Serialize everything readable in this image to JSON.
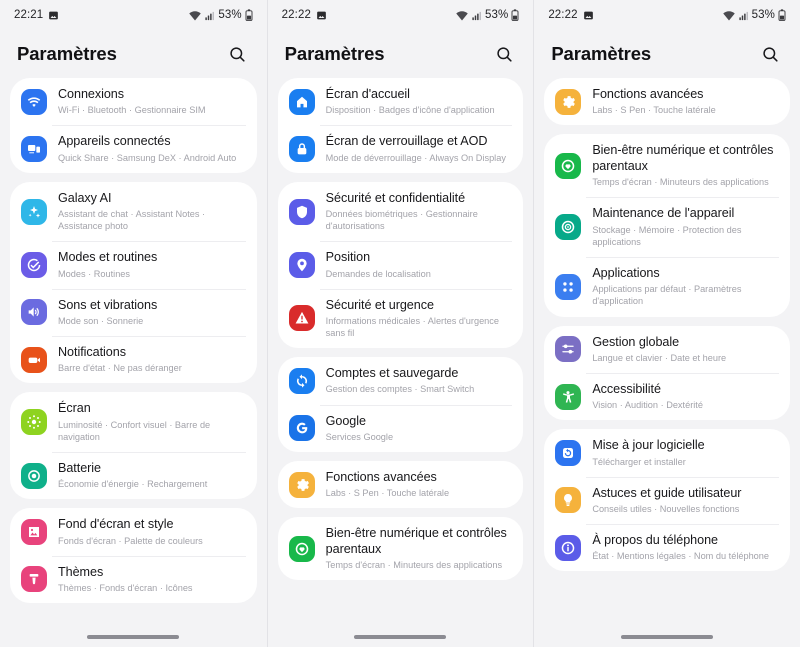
{
  "app": {
    "title": "Paramètres"
  },
  "status": {
    "time_col1": "22:21",
    "time_col2": "22:22",
    "time_col3": "22:22",
    "battery": "53%",
    "icons": [
      "gallery-icon",
      "wifi-icon",
      "signal-icon",
      "battery-icon"
    ]
  },
  "icon_colors": {
    "connexions": "#2c74f0",
    "appareils_connectes": "#2c74f0",
    "galaxy_ai": "#2fb7e8",
    "modes_routines": "#6b5ce7",
    "sons_vibrations": "#6b6be0",
    "notifications": "#e8521a",
    "ecran": "#8ed320",
    "batterie": "#0fb08a",
    "fond_ecran": "#e8437c",
    "themes": "#e8437c",
    "ecran_accueil": "#1a7ef0",
    "ecran_verrouillage": "#1a7ef0",
    "securite_conf": "#5b5ce8",
    "position": "#5b5ce8",
    "securite_urgence": "#d92b2b",
    "comptes": "#1a7ef0",
    "google": "#1a73e8",
    "fonctions_avancees": "#f5b23c",
    "bien_etre": "#18b84a",
    "maintenance": "#07a989",
    "applications": "#3b7ef0",
    "gestion_globale": "#7b6fc4",
    "accessibilite": "#2fb552",
    "mise_a_jour": "#2c74f0",
    "astuces": "#f5b23c",
    "a_propos": "#5b5ce8"
  },
  "columns": [
    {
      "name": "column-1",
      "cards": [
        {
          "rows": [
            {
              "icon": "wifi-icon",
              "key": "connexions",
              "title": "Connexions",
              "sub": "Wi-Fi  ·  Bluetooth  ·  Gestionnaire SIM"
            },
            {
              "icon": "devices-icon",
              "key": "appareils_connectes",
              "title": "Appareils connectés",
              "sub": "Quick Share  ·  Samsung DeX  ·  Android Auto"
            }
          ]
        },
        {
          "rows": [
            {
              "icon": "sparkle-icon",
              "key": "galaxy_ai",
              "title": "Galaxy AI",
              "sub": "Assistant de chat  ·  Assistant Notes  ·  Assistance photo"
            },
            {
              "icon": "check-circle-icon",
              "key": "modes_routines",
              "title": "Modes et routines",
              "sub": "Modes  ·  Routines"
            },
            {
              "icon": "speaker-icon",
              "key": "sons_vibrations",
              "title": "Sons et vibrations",
              "sub": "Mode son  ·  Sonnerie"
            },
            {
              "icon": "bell-icon",
              "key": "notifications",
              "title": "Notifications",
              "sub": "Barre d'état  ·  Ne pas déranger"
            }
          ]
        },
        {
          "rows": [
            {
              "icon": "brightness-icon",
              "key": "ecran",
              "title": "Écran",
              "sub": "Luminosité  ·  Confort visuel  ·  Barre de navigation"
            },
            {
              "icon": "battery-ring-icon",
              "key": "batterie",
              "title": "Batterie",
              "sub": "Économie d'énergie  ·  Rechargement"
            }
          ]
        },
        {
          "rows": [
            {
              "icon": "wallpaper-icon",
              "key": "fond_ecran",
              "title": "Fond d'écran et style",
              "sub": "Fonds d'écran  ·  Palette de couleurs"
            },
            {
              "icon": "brush-icon",
              "key": "themes",
              "title": "Thèmes",
              "sub": "Thèmes  ·  Fonds d'écran  ·  Icônes"
            }
          ]
        }
      ]
    },
    {
      "name": "column-2",
      "cards": [
        {
          "rows": [
            {
              "icon": "home-icon",
              "key": "ecran_accueil",
              "title": "Écran d'accueil",
              "sub": "Disposition  ·  Badges d'icône d'application"
            },
            {
              "icon": "lock-icon",
              "key": "ecran_verrouillage",
              "title": "Écran de verrouillage et AOD",
              "sub": "Mode de déverrouillage  ·  Always On Display"
            }
          ]
        },
        {
          "rows": [
            {
              "icon": "shield-icon",
              "key": "securite_conf",
              "title": "Sécurité et confidentialité",
              "sub": "Données biométriques  ·  Gestionnaire d'autorisations"
            },
            {
              "icon": "pin-icon",
              "key": "position",
              "title": "Position",
              "sub": "Demandes de localisation"
            },
            {
              "icon": "alert-icon",
              "key": "securite_urgence",
              "title": "Sécurité et urgence",
              "sub": "Informations médicales  ·  Alertes d'urgence sans fil"
            }
          ]
        },
        {
          "rows": [
            {
              "icon": "sync-icon",
              "key": "comptes",
              "title": "Comptes et sauvegarde",
              "sub": "Gestion des comptes  ·  Smart Switch"
            },
            {
              "icon": "google-icon",
              "key": "google",
              "title": "Google",
              "sub": "Services Google"
            }
          ]
        },
        {
          "rows": [
            {
              "icon": "gear-icon",
              "key": "fonctions_avancees",
              "title": "Fonctions avancées",
              "sub": "Labs  ·  S Pen  ·  Touche latérale"
            }
          ]
        },
        {
          "rows": [
            {
              "icon": "heart-icon",
              "key": "bien_etre",
              "title": "Bien-être numérique et contrôles parentaux",
              "sub": "Temps d'écran  ·  Minuteurs des applications"
            }
          ]
        }
      ]
    },
    {
      "name": "column-3",
      "cards": [
        {
          "rows": [
            {
              "icon": "gear-icon",
              "key": "fonctions_avancees",
              "title": "Fonctions avancées",
              "sub": "Labs  ·  S Pen  ·  Touche latérale"
            }
          ]
        },
        {
          "rows": [
            {
              "icon": "heart-icon",
              "key": "bien_etre",
              "title": "Bien-être numérique et contrôles parentaux",
              "sub": "Temps d'écran  ·  Minuteurs des applications"
            },
            {
              "icon": "maintenance-icon",
              "key": "maintenance",
              "title": "Maintenance de l'appareil",
              "sub": "Stockage  ·  Mémoire  ·  Protection des applications"
            },
            {
              "icon": "apps-grid-icon",
              "key": "applications",
              "title": "Applications",
              "sub": "Applications par défaut  ·  Paramètres d'application"
            }
          ]
        },
        {
          "rows": [
            {
              "icon": "sliders-icon",
              "key": "gestion_globale",
              "title": "Gestion globale",
              "sub": "Langue et clavier  ·  Date et heure"
            },
            {
              "icon": "accessibility-icon",
              "key": "accessibilite",
              "title": "Accessibilité",
              "sub": "Vision  ·  Audition  ·  Dextérité"
            }
          ]
        },
        {
          "rows": [
            {
              "icon": "update-icon",
              "key": "mise_a_jour",
              "title": "Mise à jour logicielle",
              "sub": "Télécharger et installer"
            },
            {
              "icon": "bulb-icon",
              "key": "astuces",
              "title": "Astuces et guide utilisateur",
              "sub": "Conseils utiles  ·  Nouvelles fonctions"
            },
            {
              "icon": "info-icon",
              "key": "a_propos",
              "title": "À propos du téléphone",
              "sub": "État  ·  Mentions légales  ·  Nom du téléphone"
            }
          ]
        }
      ]
    }
  ]
}
